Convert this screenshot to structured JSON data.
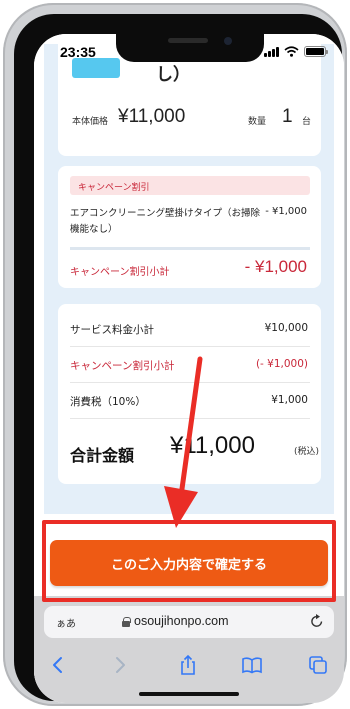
{
  "status_bar": {
    "time": "23:35"
  },
  "product": {
    "name_tail": "し）",
    "price_label": "本体価格",
    "price": "¥11,000",
    "qty_label": "数量",
    "qty": "1",
    "qty_unit": "台"
  },
  "campaign": {
    "header": "キャンペーン割引",
    "item_name": "エアコンクリーニング壁掛けタイプ（お掃除機能なし）",
    "item_price": "- ¥1,000",
    "subtotal_label": "キャンペーン割引小計",
    "subtotal_value": "- ¥1,000"
  },
  "summary": {
    "service_label": "サービス料金小計",
    "service_value": "¥10,000",
    "campaign_label": "キャンペーン割引小計",
    "campaign_value": "(- ¥1,000)",
    "tax_label": "消費税（10%）",
    "tax_value": "¥1,000",
    "total_label": "合計金額",
    "total_value": "¥11,000",
    "total_tax_note": "(税込)"
  },
  "confirm_button": {
    "label": "このご入力内容で確定する"
  },
  "browser": {
    "text_size_label": "ぁあ",
    "url": "osoujihonpo.com"
  },
  "colors": {
    "accent_red": "#c9283a",
    "button_orange": "#ee5a14",
    "highlight_red": "#ea2d26",
    "panel_blue": "#e4eff9",
    "thumb_blue": "#56c8ef",
    "ios_blue": "#3478f6"
  },
  "icons": {
    "lock": "lock-icon",
    "reload": "reload-icon",
    "back": "chevron-left-icon",
    "forward": "chevron-right-icon",
    "share": "share-icon",
    "bookmarks": "book-icon",
    "tabs": "tabs-icon"
  }
}
